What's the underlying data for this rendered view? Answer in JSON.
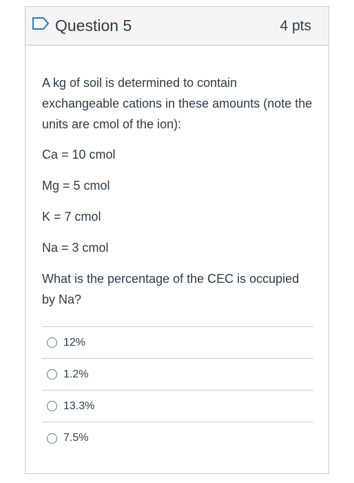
{
  "question": {
    "title": "Question 5",
    "points": "4 pts",
    "flag_icon": "flag-icon",
    "text": {
      "intro": "A kg of soil is determined to contain exchangeable cations in these amounts (note the units are cmol of the ion):",
      "lines": [
        "Ca = 10 cmol",
        "Mg = 5 cmol",
        "K = 7 cmol",
        "Na = 3 cmol"
      ],
      "prompt": "What is the percentage of the CEC is occupied by Na?"
    },
    "answers": [
      "12%",
      "1.2%",
      "13.3%",
      "7.5%"
    ]
  },
  "colors": {
    "header_bg": "#f5f5f5",
    "border": "#c7cdd1",
    "text": "#2d3b45",
    "flag": "#2b7abc"
  }
}
